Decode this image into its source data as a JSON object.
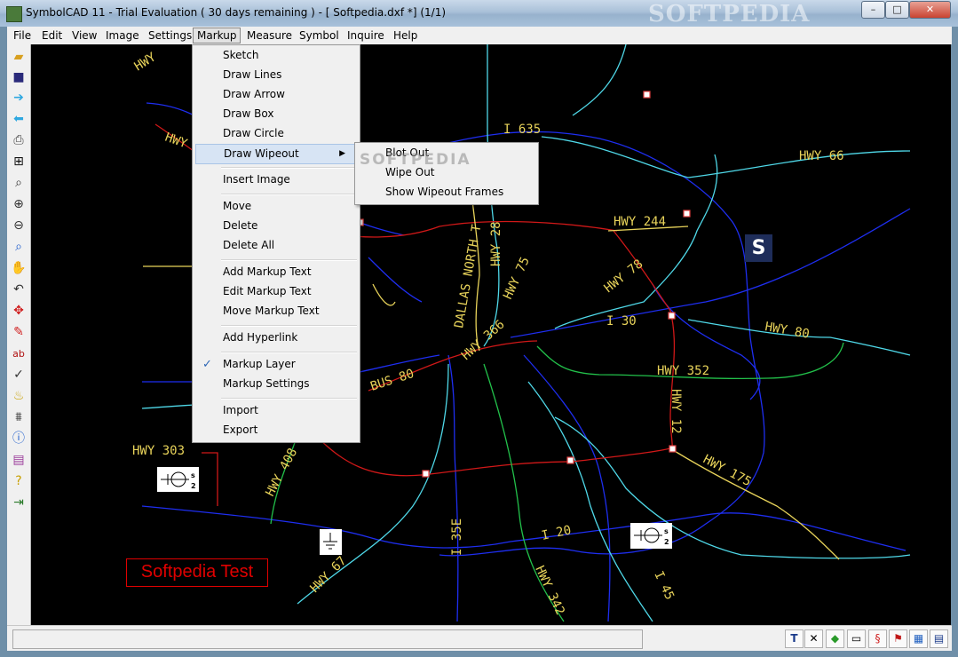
{
  "window": {
    "title": "SymbolCAD 11 - Trial Evaluation ( 30 days remaining )  -  [ Softpedia.dxf *] (1/1)",
    "watermark": "SOFTPEDIA",
    "controls": {
      "minimize": "–",
      "maximize": "□",
      "close": "✕"
    }
  },
  "menubar": [
    "File",
    "Edit",
    "View",
    "Image",
    "Settings",
    "Markup",
    "Measure",
    "Symbol",
    "Inquire",
    "Help"
  ],
  "menubar_active": "Markup",
  "markup_menu": {
    "items": [
      "Sketch",
      "Draw Lines",
      "Draw Arrow",
      "Draw Box",
      "Draw Circle",
      "Draw Wipeout",
      "Insert Image",
      "Move",
      "Delete",
      "Delete All",
      "Add Markup Text",
      "Edit Markup Text",
      "Move Markup Text",
      "Add Hyperlink",
      "Markup Layer",
      "Markup Settings",
      "Import",
      "Export"
    ],
    "highlighted": "Draw Wipeout",
    "checked": "Markup Layer",
    "check_glyph": "✓",
    "submenu_arrow": "▶"
  },
  "wipeout_submenu": {
    "items": [
      "Blot Out",
      "Wipe Out",
      "Show Wipeout Frames"
    ]
  },
  "center_watermark": "SOFTPEDIA",
  "map_labels": {
    "hwy_tl": "HWY",
    "hwy_ml": "HWY",
    "i635": "I 635",
    "hwy66": "HWY 66",
    "dallas": "DALLAS NORTH T",
    "hwy289": "HWY 28",
    "hwy75": "HWY 75",
    "hwy244": "HWY 244",
    "hwy78": "HWY 78",
    "i30": "I 30",
    "hwy80": "HWY 80",
    "hwy366": "HWY 366",
    "bus80": "BUS 80",
    "hwy352": "HWY 352",
    "hwy12": "HWY 12",
    "hwy303": "HWY 303",
    "hwy408": "HWY 408",
    "hwy175": "HWY 175",
    "i35e": "I 35E",
    "i20": "I 20",
    "hwy67": "HWY 67",
    "hwy342": "HWY 342",
    "i45": "I 45"
  },
  "logo_letter": "S",
  "softpedia_test": "Softpedia Test",
  "symbol_superscript": "s",
  "symbol_subscript": "2",
  "status_icons": [
    "text-tool-icon",
    "cancel-icon",
    "layer-icon",
    "window-icon",
    "snap-icon",
    "style-icon",
    "color-icon",
    "display-icon"
  ],
  "status_glyphs": [
    "T",
    "✕",
    "◆",
    "▭",
    "§",
    "⚑",
    "▦",
    "▤"
  ],
  "colors": {
    "road_blue": "#1e2ef0",
    "road_cyan": "#4fd8e8",
    "road_red": "#d01818",
    "road_yellow": "#e8d35a",
    "road_green": "#22c04a",
    "label": "#e8d35a",
    "highlight": "#d7e4f4",
    "marker": "#e04040"
  }
}
